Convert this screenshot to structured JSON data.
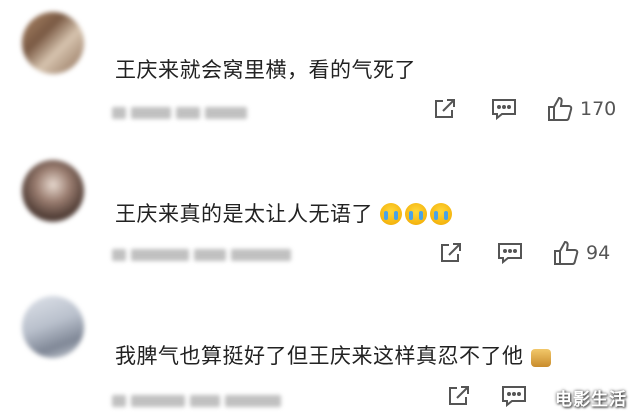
{
  "comments": [
    {
      "text": "王庆来就会窝里横，看的气死了",
      "like_count": "170"
    },
    {
      "text": "王庆来真的是太让人无语了",
      "emojis": [
        "crying-face-emoji",
        "crying-face-emoji",
        "crying-face-emoji"
      ],
      "like_count": "94"
    },
    {
      "text": "我脾气也算挺好了但王庆来这样真忍不了他",
      "emojis": [
        "small-sticker-emoji"
      ],
      "like_count": ""
    }
  ],
  "icons": {
    "share": "share-icon",
    "reply": "comment-icon",
    "like": "thumbs-up-icon"
  },
  "watermark": "电影生活",
  "colors": {
    "icon": "#555555",
    "text": "#222222"
  }
}
